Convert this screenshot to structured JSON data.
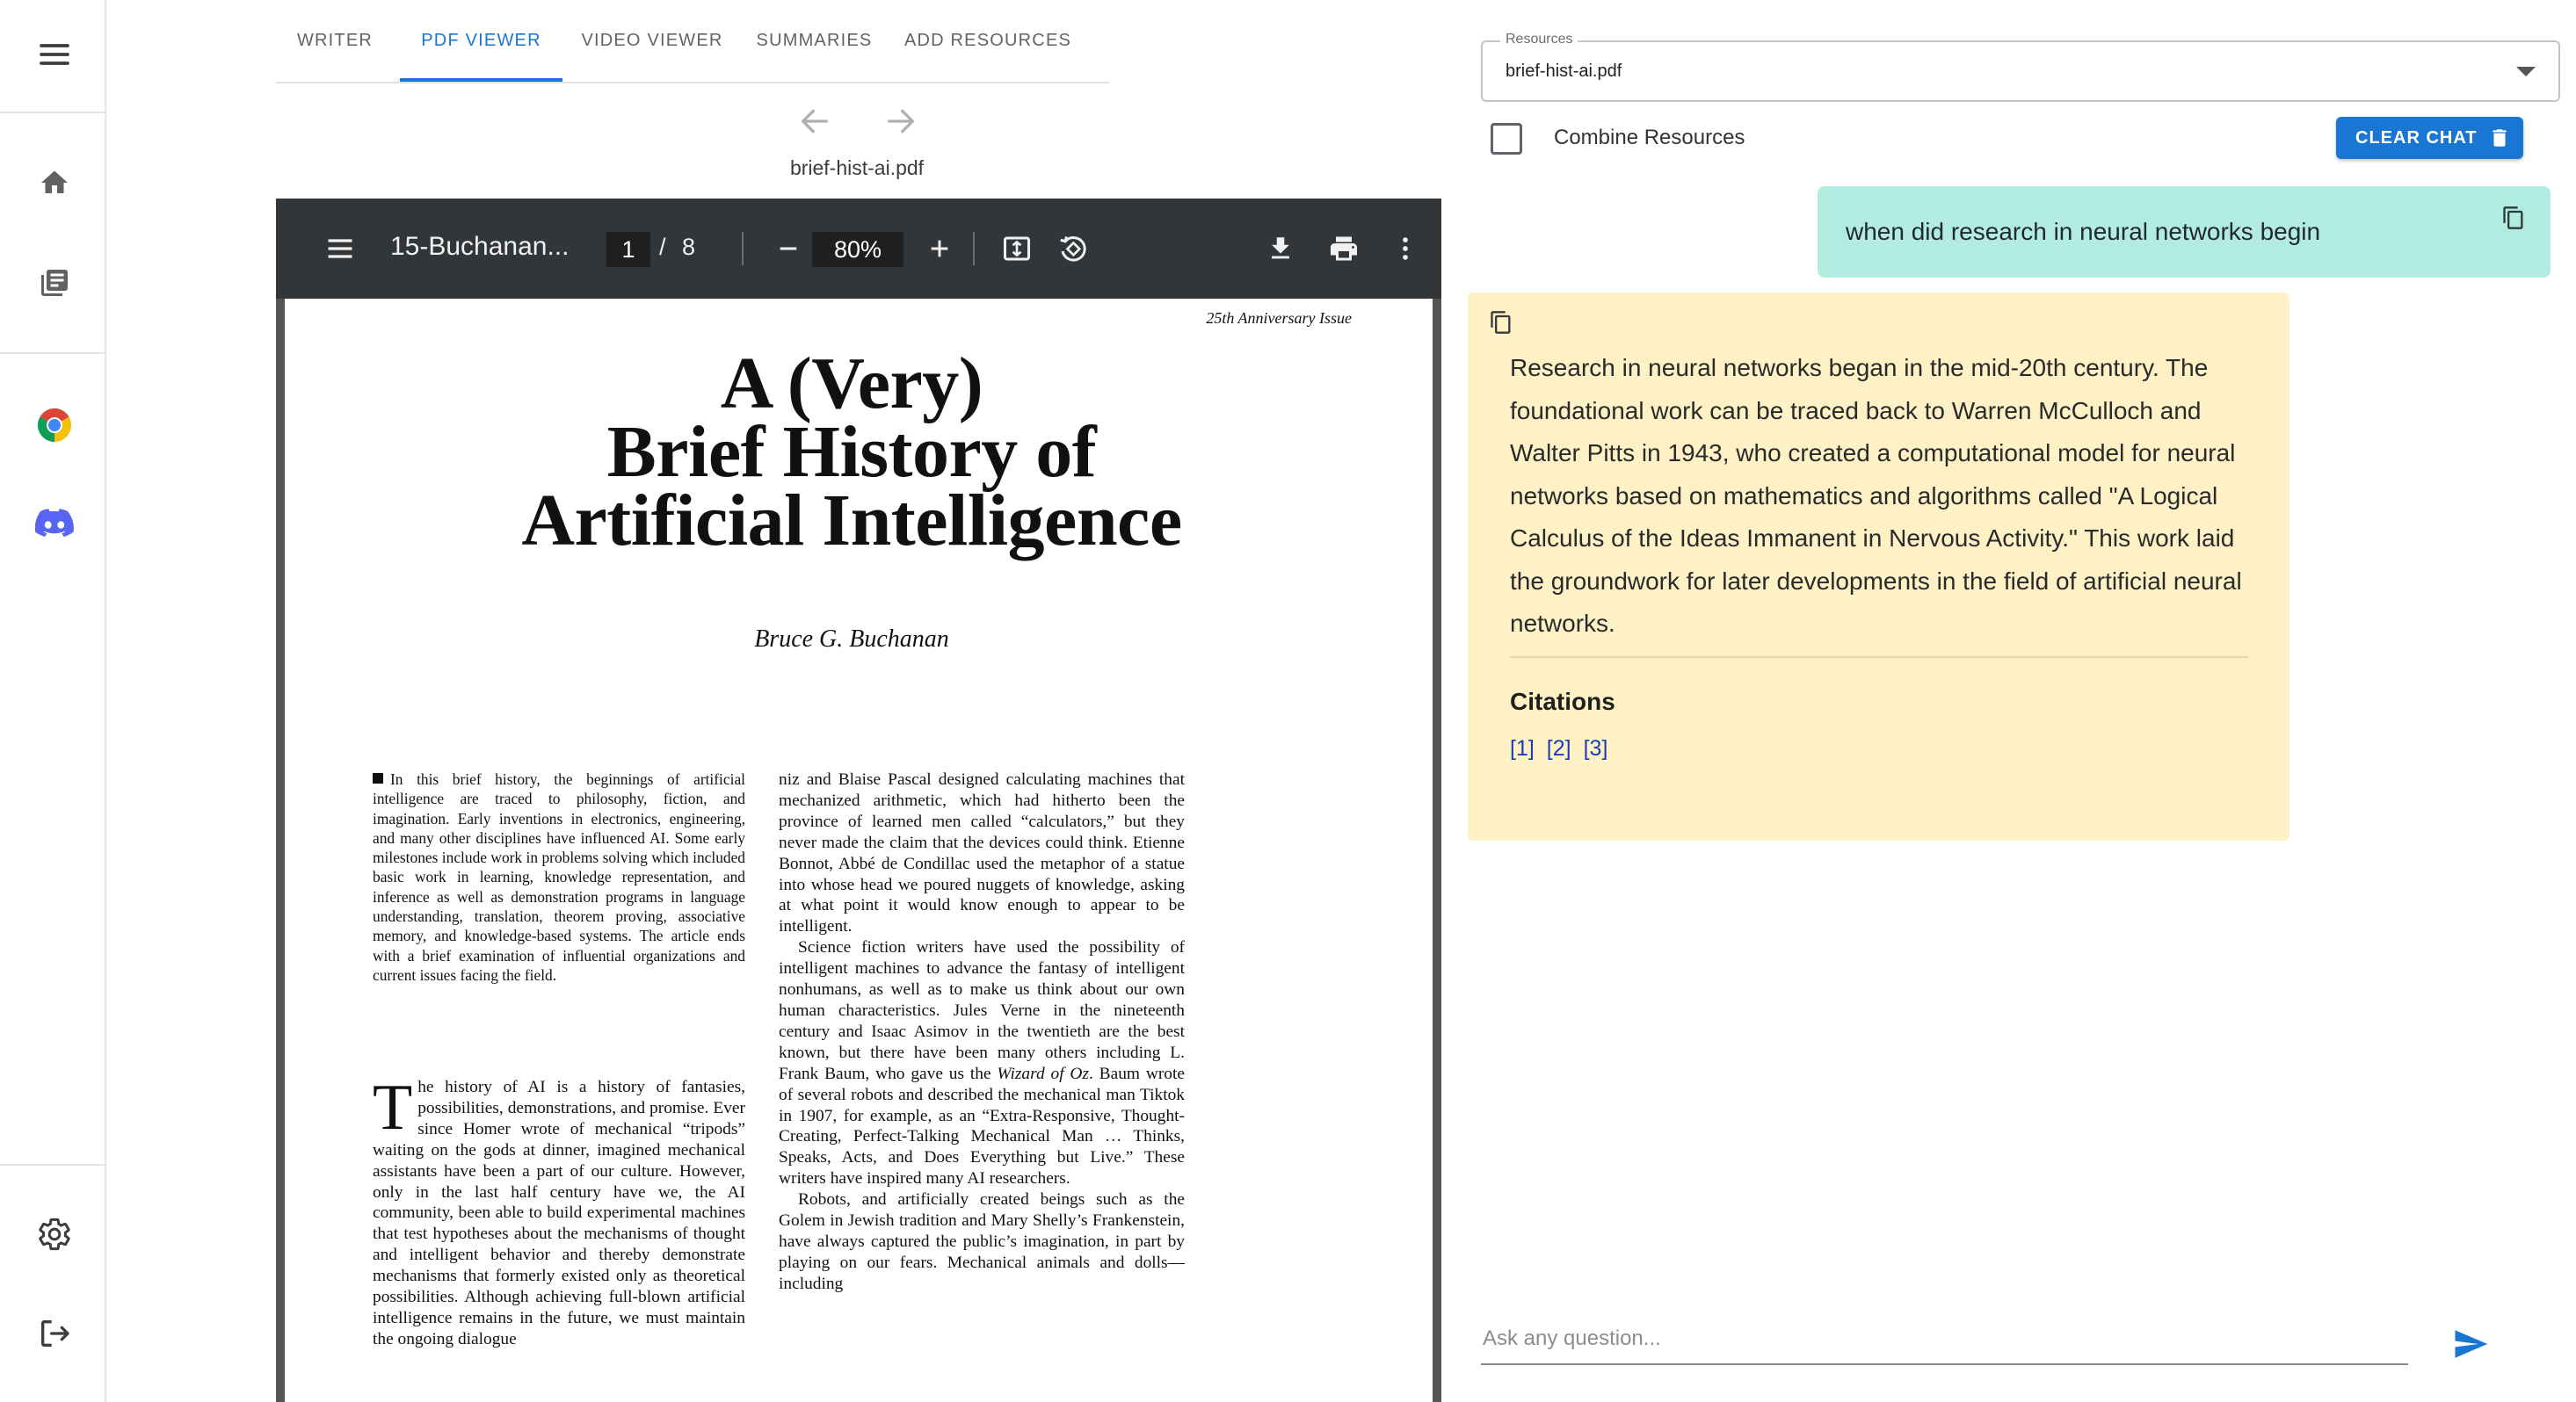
{
  "nav_rail": {
    "items": [
      {
        "name": "menu-icon"
      },
      {
        "name": "home-icon"
      },
      {
        "name": "library-icon"
      },
      {
        "name": "chrome-icon"
      },
      {
        "name": "discord-icon"
      },
      {
        "name": "settings-icon"
      },
      {
        "name": "logout-icon"
      }
    ]
  },
  "tabs": [
    {
      "label": "WRITER",
      "active": false
    },
    {
      "label": "PDF VIEWER",
      "active": true
    },
    {
      "label": "VIDEO VIEWER",
      "active": false
    },
    {
      "label": "SUMMARIES",
      "active": false
    },
    {
      "label": "ADD RESOURCES",
      "active": false
    }
  ],
  "pdf": {
    "filename": "brief-hist-ai.pdf",
    "toolbar": {
      "doc_title": "15-Buchanan...",
      "page_current": "1",
      "page_separator": "/",
      "page_total": "8",
      "zoom": "80%"
    },
    "page": {
      "issue_label": "25th Anniversary Issue",
      "title_line1": "A (Very)",
      "title_line2": "Brief History of",
      "title_line3": "Artificial Intelligence",
      "author": "Bruce G. Buchanan",
      "abstract": "In this brief history, the beginnings of artificial intelligence are traced to philosophy, fiction, and imagination. Early inventions in electronics, engineering, and many other disciplines have influenced AI. Some early milestones include work in problems solving which included basic work in learning, knowledge representation, and inference as well as demonstration programs in language understanding, translation, theorem proving, associative memory, and knowledge-based systems. The article ends with a brief examination of influential organizations and current issues facing the field.",
      "body1_dropcap": "T",
      "body1": "he history of AI is a history of fantasies, possibilities, demonstrations, and promise. Ever since Homer wrote of mechanical “tripods” waiting on the gods at dinner, imagined mechanical assistants have been a part of our culture. However, only in the last half century have we, the AI community, been able to build experimental machines that test hypotheses about the mechanisms of thought and intelligent behavior and thereby demonstrate mechanisms that formerly existed only as theoretical possibilities. Although achieving full-blown artificial intelligence remains in the future, we must maintain the ongoing dialogue",
      "body2_p1": "niz and Blaise Pascal designed calculating machines that mechanized arithmetic, which had hitherto been the province of learned men called “calculators,” but they never made the claim that the devices could think. Etienne Bonnot, Abbé de Condillac used the metaphor of a statue into whose head we poured nuggets of knowledge, asking at what point it would know enough to appear to be intelligent.",
      "body2_p2_before": "Science fiction writers have used the possibility of intelligent machines to advance the fantasy of intelligent nonhumans, as well as to make us think about our own human characteristics. Jules Verne in the nineteenth century and Isaac Asimov in the twentieth are the best known, but there have been many others including L. Frank Baum, who gave us the ",
      "body2_p2_italic": "Wizard of Oz",
      "body2_p2_after": ". Baum wrote of several robots and described the mechanical man Tiktok in 1907, for example, as an “Extra-Responsive, Thought-Creating, Perfect-Talking Mechanical Man … Thinks, Speaks, Acts, and Does Everything but Live.” These writers have inspired many AI researchers.",
      "body2_p3": "Robots, and artificially created beings such as the Golem in Jewish tradition and Mary Shelly’s Frankenstein, have always captured the public’s imagination, in part by playing on our fears. Mechanical animals and dolls—including"
    }
  },
  "chat": {
    "resources_label": "Resources",
    "resources_value": "brief-hist-ai.pdf",
    "combine_label": "Combine Resources",
    "combine_checked": false,
    "clear_chat_label": "CLEAR CHAT",
    "user_message": "when did research in neural networks begin",
    "bot_message": "Research in neural networks began in the mid-20th century. The foundational work can be traced back to Warren McCulloch and Walter Pitts in 1943, who created a computational model for neural networks based on mathematics and algorithms called \"A Logical Calculus of the Ideas Immanent in Nervous Activity.\" This work laid the groundwork for later developments in the field of artificial neural networks.",
    "citations_title": "Citations",
    "citations": [
      "[1]",
      "[2]",
      "[3]"
    ],
    "input_placeholder": "Ask any question...",
    "input_value": ""
  },
  "colors": {
    "accent": "#1976d2",
    "user_bubble": "#b2ebdf",
    "bot_bubble": "#fdf1c5",
    "pdf_toolbar": "#323639",
    "discord": "#5865f2"
  }
}
